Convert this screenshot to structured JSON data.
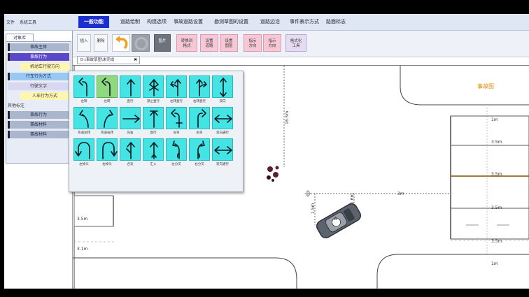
{
  "menubar": {
    "left_items": [
      "文件",
      "系统工具"
    ],
    "tabs": [
      {
        "label": "一般功能",
        "active": true
      },
      {
        "label": "道路绘制",
        "active": false
      },
      {
        "label": "构建选项",
        "active": false
      },
      {
        "label": "事故道路设置",
        "active": false
      },
      {
        "label": "勘测草图的设置",
        "active": false
      },
      {
        "label": "道路边沿",
        "active": false
      },
      {
        "label": "事件表示方式",
        "active": false
      },
      {
        "label": "路面标志",
        "active": false
      }
    ]
  },
  "left_panel": {
    "tab": "对象库",
    "rows": [
      {
        "label": "事故主体",
        "style": "gray",
        "marker": true
      },
      {
        "label": "事故行为",
        "style": "purple",
        "marker": true
      },
      {
        "label": "机动车行驶方向",
        "style": "yellow",
        "marker": false
      },
      {
        "label": "行车行为方式",
        "style": "lightblue",
        "marker": true
      },
      {
        "label": "行驶文字",
        "style": "lav",
        "marker": false
      },
      {
        "label": "人车行为方式",
        "style": "yellow",
        "marker": false
      },
      {
        "label": "其他标注",
        "style": "plain",
        "marker": false
      },
      {
        "label": "事故行为",
        "style": "gray",
        "marker": true
      },
      {
        "label": "事故材料",
        "style": "gray",
        "marker": true
      },
      {
        "label": "事故材料",
        "style": "gray",
        "marker": true
      }
    ]
  },
  "toolbar": {
    "buttons": [
      {
        "label": "插入",
        "style": "plain"
      },
      {
        "label": "删除",
        "style": "plain"
      },
      {
        "label": "",
        "icon": "undo-icon",
        "style": "plain"
      },
      {
        "label": "",
        "icon": "redo-icon",
        "style": "gray"
      },
      {
        "label": "图片",
        "style": "dark"
      },
      {
        "label": "转换到\n格式",
        "style": "pink"
      },
      {
        "label": "设置\n道路",
        "style": "pink"
      },
      {
        "label": "设置\n图层",
        "style": "pink"
      },
      {
        "label": "指示\n方向",
        "style": "pink"
      },
      {
        "label": "指示\n方向",
        "style": "pink"
      },
      {
        "label": "格式化\n工具",
        "style": "lilac"
      }
    ]
  },
  "doc_tab": {
    "label": "D:\\事故草图\\未完成",
    "close_icon": "close-icon"
  },
  "canvas": {
    "labels": {
      "top_right": "事故图",
      "m1a": "1m",
      "m35a": "3.5m",
      "m35b": "3.5m",
      "m35c": "3.5m",
      "m35d": "3.5m",
      "m1b": "1m",
      "left_2m": "2m",
      "left_35m": "3.5m",
      "left_31m": "3.1m",
      "dim_mid": "3m",
      "dim_vert": "1.5m",
      "dim_small": "1.6m",
      "dim_top_vert": "16.5m",
      "vehicle": "A",
      "marker": "B"
    }
  },
  "arrow_popup": {
    "cells": [
      {
        "icon": "left-turn-arrow-icon",
        "caption": "左转"
      },
      {
        "icon": "left-turn-arrow-icon",
        "caption": "左转",
        "selected": true
      },
      {
        "icon": "straight-arrow-icon",
        "caption": "直行"
      },
      {
        "icon": "no-straight-icon",
        "caption": "禁止直行"
      },
      {
        "icon": "left-straight-arrow-icon",
        "caption": "左转直行"
      },
      {
        "icon": "right-straight-arrow-icon",
        "caption": "右转直行"
      },
      {
        "icon": "up-down-arrow-icon",
        "caption": "双向"
      },
      {
        "icon": "curve-left-arrow-icon",
        "caption": "弯道左转"
      },
      {
        "icon": "curve-right-arrow-icon",
        "caption": "弯道右转"
      },
      {
        "icon": "right-arrow-icon",
        "caption": "向右"
      },
      {
        "icon": "up-arrow-bar-icon",
        "caption": "直行"
      },
      {
        "icon": "left-hook-arrow-icon",
        "caption": "左弯"
      },
      {
        "icon": "right-hook-arrow-icon",
        "caption": "右弯"
      },
      {
        "icon": "left-right-arrow-icon",
        "caption": "双向通行"
      },
      {
        "icon": "u-turn-left-icon",
        "caption": "左掉头"
      },
      {
        "icon": "u-turn-right-icon",
        "caption": "右掉头"
      },
      {
        "icon": "merge-left-icon",
        "caption": "合流"
      },
      {
        "icon": "merge-arrow-icon",
        "caption": "汇入"
      },
      {
        "icon": "left-fork-icon",
        "caption": "左分叉"
      },
      {
        "icon": "right-fork-icon",
        "caption": "右分叉"
      },
      {
        "icon": "left-right-arrow-icon",
        "caption": "双向通行"
      }
    ]
  }
}
